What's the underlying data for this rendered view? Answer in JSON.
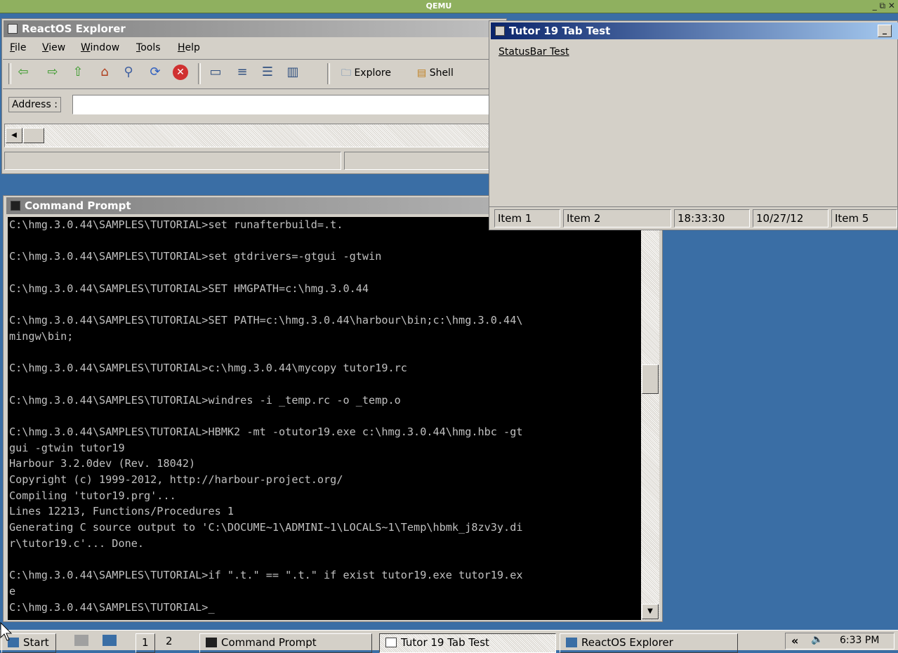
{
  "qemu": {
    "title": "QEMU",
    "controls": "_ ⧉ ✕"
  },
  "explorer": {
    "title": "ReactOS Explorer",
    "menu": [
      "File",
      "View",
      "Window",
      "Tools",
      "Help"
    ],
    "toolbar": {
      "explore": "Explore",
      "shell": "Shell"
    },
    "address_label": "Address :",
    "address_value": ""
  },
  "tutor": {
    "title": "Tutor 19 Tab Test",
    "menu_item": "StatusBar Test",
    "status": [
      "Item 1",
      "Item 2",
      "18:33:30",
      "10/27/12",
      "Item 5"
    ]
  },
  "cmd": {
    "title": "Command Prompt",
    "lines": [
      "C:\\hmg.3.0.44\\SAMPLES\\TUTORIAL>set runafterbuild=.t.",
      "",
      "C:\\hmg.3.0.44\\SAMPLES\\TUTORIAL>set gtdrivers=-gtgui -gtwin",
      "",
      "C:\\hmg.3.0.44\\SAMPLES\\TUTORIAL>SET HMGPATH=c:\\hmg.3.0.44",
      "",
      "C:\\hmg.3.0.44\\SAMPLES\\TUTORIAL>SET PATH=c:\\hmg.3.0.44\\harbour\\bin;c:\\hmg.3.0.44\\",
      "mingw\\bin;",
      "",
      "C:\\hmg.3.0.44\\SAMPLES\\TUTORIAL>c:\\hmg.3.0.44\\mycopy tutor19.rc",
      "",
      "C:\\hmg.3.0.44\\SAMPLES\\TUTORIAL>windres -i _temp.rc -o _temp.o",
      "",
      "C:\\hmg.3.0.44\\SAMPLES\\TUTORIAL>HBMK2 -mt -otutor19.exe c:\\hmg.3.0.44\\hmg.hbc -gt",
      "gui -gtwin tutor19",
      "Harbour 3.2.0dev (Rev. 18042)",
      "Copyright (c) 1999-2012, http://harbour-project.org/",
      "Compiling 'tutor19.prg'...",
      "Lines 12213, Functions/Procedures 1",
      "Generating C source output to 'C:\\DOCUME~1\\ADMINI~1\\LOCALS~1\\Temp\\hbmk_j8zv3y.di",
      "r\\tutor19.c'... Done.",
      "",
      "C:\\hmg.3.0.44\\SAMPLES\\TUTORIAL>if \".t.\" == \".t.\" if exist tutor19.exe tutor19.ex",
      "e",
      "C:\\hmg.3.0.44\\SAMPLES\\TUTORIAL>_"
    ]
  },
  "taskbar": {
    "start": "Start",
    "desktops": [
      "1",
      "2"
    ],
    "tasks": [
      "Command Prompt",
      "Tutor 19 Tab Test",
      "ReactOS Explorer"
    ],
    "clock": "6:33 PM",
    "tray_arrow": "«"
  }
}
